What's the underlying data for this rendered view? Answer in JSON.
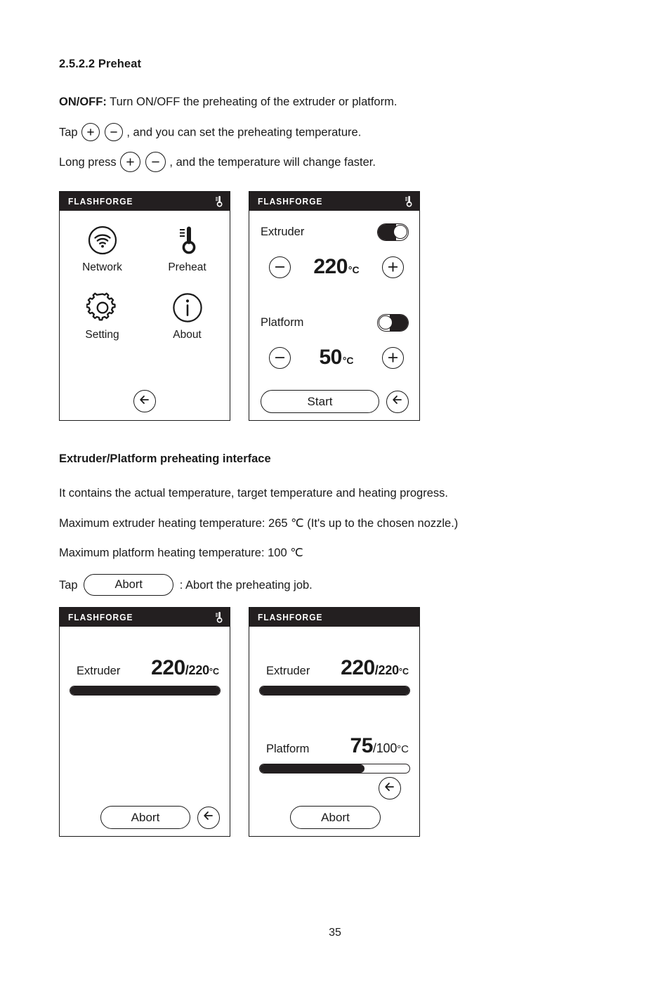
{
  "document": {
    "section_number_title": "2.5.2.2 Preheat",
    "page_number": "35",
    "paragraphs": {
      "onoff_lead": "ON/OFF:",
      "onoff_rest": " Turn ON/OFF the preheating of the extruder or platform.",
      "tap_lead": "Tap",
      "tap_rest": ", and you can set the preheating temperature.",
      "longpress_lead": "Long press",
      "longpress_rest": ", and the temperature will change faster.",
      "subheading": "Extruder/Platform preheating interface",
      "contains": "It contains the actual temperature, target temperature and heating progress.",
      "max_extruder": "Maximum extruder heating temperature: 265 ℃ (It's up to the chosen nozzle.)",
      "max_platform": "Maximum platform heating temperature: 100 ℃",
      "tap_abort_lead": "Tap",
      "tap_abort_button": "Abort",
      "tap_abort_rest": ": Abort the preheating job."
    }
  },
  "brand": "FLASHFORGE",
  "screen_menu": {
    "title": "FLASHFORGE",
    "header_icon": "thermometer-icon",
    "items": [
      {
        "label": "Network",
        "icon": "wifi-icon"
      },
      {
        "label": "Preheat",
        "icon": "thermometer-icon"
      },
      {
        "label": "Setting",
        "icon": "gear-icon"
      },
      {
        "label": "About",
        "icon": "info-icon"
      }
    ],
    "back_icon": "back-arrow-icon"
  },
  "screen_set_temp": {
    "title": "FLASHFORGE",
    "header_icon": "thermometer-icon",
    "extruder": {
      "label": "Extruder",
      "toggle_state": "on",
      "minus_label": "−",
      "plus_label": "+",
      "value": "220",
      "unit": "°C"
    },
    "platform": {
      "label": "Platform",
      "toggle_state": "off",
      "minus_label": "−",
      "plus_label": "+",
      "value": "50",
      "unit": "°C"
    },
    "start_label": "Start",
    "back_icon": "back-arrow-icon"
  },
  "screen_preheat_extruder": {
    "title": "FLASHFORGE",
    "header_icon": "thermometer-icon",
    "extruder": {
      "label": "Extruder",
      "current": "220",
      "target": "/220",
      "unit": "°C",
      "progress_percent": 100
    },
    "abort_label": "Abort",
    "back_icon": "back-arrow-icon"
  },
  "screen_preheat_both": {
    "title": "FLASHFORGE",
    "header_icon": "none",
    "extruder": {
      "label": "Extruder",
      "current": "220",
      "target": "/220",
      "unit": "°C",
      "progress_percent": 100
    },
    "platform": {
      "label": "Platform",
      "current": "75",
      "target": "/100",
      "unit": "°C",
      "progress_percent": 70
    },
    "abort_label": "Abort",
    "back_icon": "back-arrow-icon"
  },
  "colors": {
    "ink": "#1a1a1a",
    "header_bg": "#231f20",
    "paper": "#ffffff"
  }
}
